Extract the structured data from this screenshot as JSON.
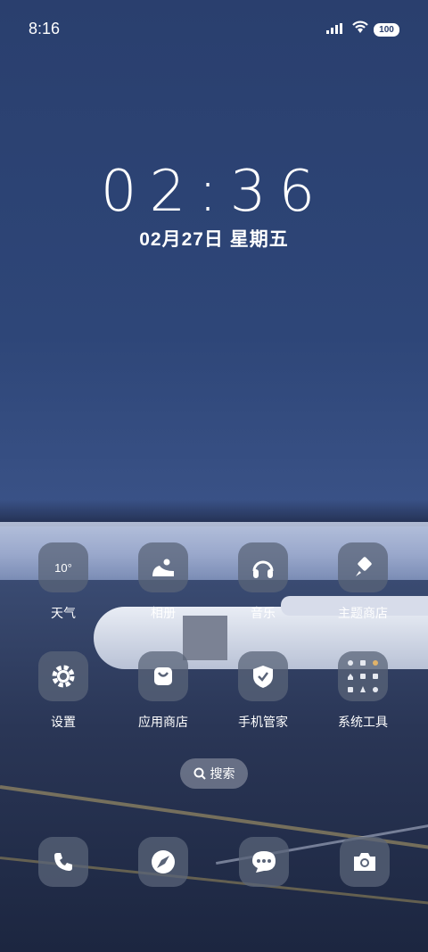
{
  "status_bar": {
    "time": "8:16",
    "battery": "100",
    "signal_icon": "signal-bars-icon",
    "wifi_icon": "wifi-icon"
  },
  "clock": {
    "time": "02:36",
    "date": "02月27日 星期五"
  },
  "apps": [
    {
      "label": "天气",
      "icon": "weather-icon",
      "icon_text": "10°"
    },
    {
      "label": "相册",
      "icon": "gallery-icon"
    },
    {
      "label": "音乐",
      "icon": "headphones-icon"
    },
    {
      "label": "主题商店",
      "icon": "brush-icon"
    },
    {
      "label": "设置",
      "icon": "gear-icon"
    },
    {
      "label": "应用商店",
      "icon": "shopping-bag-icon"
    },
    {
      "label": "手机管家",
      "icon": "shield-check-icon"
    },
    {
      "label": "系统工具",
      "icon": "folder-grid-icon"
    }
  ],
  "search": {
    "label": "搜索",
    "icon": "search-icon"
  },
  "dock": [
    {
      "icon": "phone-icon"
    },
    {
      "icon": "compass-browser-icon"
    },
    {
      "icon": "message-icon"
    },
    {
      "icon": "camera-icon"
    }
  ],
  "colors": {
    "accent": "#2e4678",
    "icon_bg": "#5a6478"
  }
}
